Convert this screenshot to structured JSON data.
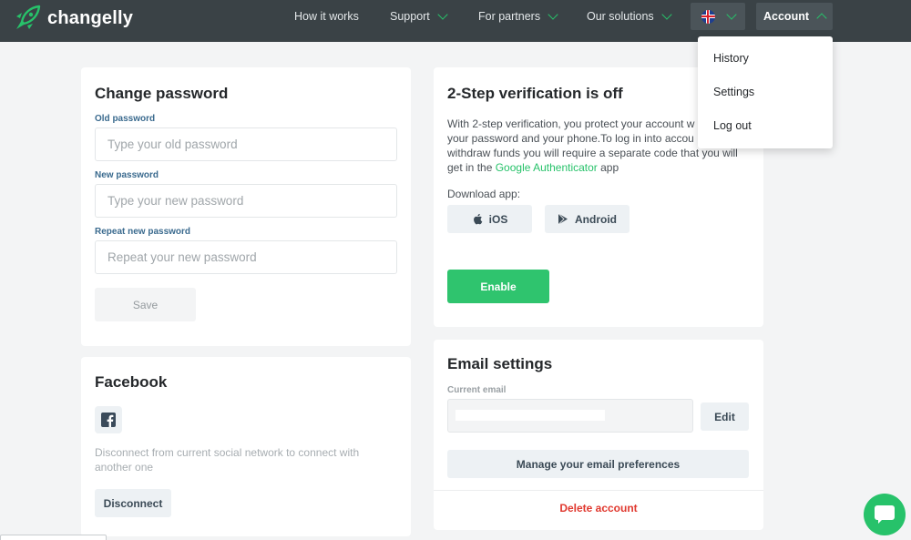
{
  "brand": {
    "name": "changelly"
  },
  "nav": {
    "how_it_works": "How it works",
    "support": "Support",
    "for_partners": "For partners",
    "our_solutions": "Our solutions",
    "account": "Account"
  },
  "account_menu": [
    "History",
    "Settings",
    "Log out"
  ],
  "change_password": {
    "title": "Change password",
    "old_label": "Old password",
    "old_placeholder": "Type your old password",
    "new_label": "New password",
    "new_placeholder": "Type your new password",
    "repeat_label": "Repeat new password",
    "repeat_placeholder": "Repeat your new password",
    "save": "Save"
  },
  "facebook": {
    "title": "Facebook",
    "description": "Disconnect from current social network to connect with another one",
    "disconnect": "Disconnect"
  },
  "two_step": {
    "title": "2-Step verification is off",
    "desc_line1": "With 2-step verification, you protect your account w",
    "desc_line2": "your password and your phone.To log in into accou",
    "desc_line3": "withdraw funds you will require a separate code that you will",
    "desc_line4_pre": "get in the ",
    "desc_link": "Google Authenticator",
    "desc_line4_post": " app",
    "download_label": "Download app:",
    "ios": "iOS",
    "android": "Android",
    "enable": "Enable"
  },
  "email_settings": {
    "title": "Email settings",
    "current_label": "Current email",
    "edit": "Edit",
    "manage": "Manage your email preferences",
    "delete": "Delete account"
  },
  "colors": {
    "header_bg": "#3a4246",
    "accent_green": "#27c26a",
    "danger_red": "#e0382e"
  }
}
